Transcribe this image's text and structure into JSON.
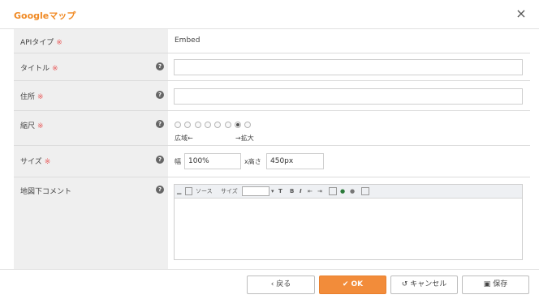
{
  "dialog": {
    "title": "Googleマップ",
    "close": "×"
  },
  "form": {
    "required_mark": "※",
    "help_icon": "?",
    "api_type": {
      "label": "APIタイプ",
      "value": "Embed"
    },
    "title_field": {
      "label": "タイトル",
      "value": ""
    },
    "address_field": {
      "label": "住所",
      "value": ""
    },
    "scale": {
      "label": "縮尺",
      "min_label": "広域←",
      "max_label": "→拡大",
      "options_count": 8,
      "selected_index": 6
    },
    "size": {
      "label": "サイズ",
      "width_label": "幅",
      "width_value": "100%",
      "height_label": "x高さ",
      "height_value": "450px"
    },
    "comment": {
      "label": "地図下コメント",
      "toolbar_source": "ソース",
      "toolbar_size": "サイズ"
    }
  },
  "footer": {
    "back": "戻る",
    "ok": "OK",
    "cancel": "キャンセル",
    "save": "保存"
  },
  "colors": {
    "accent": "#f08a24",
    "ok_button": "#f28c3a",
    "required": "#e85a5a"
  }
}
